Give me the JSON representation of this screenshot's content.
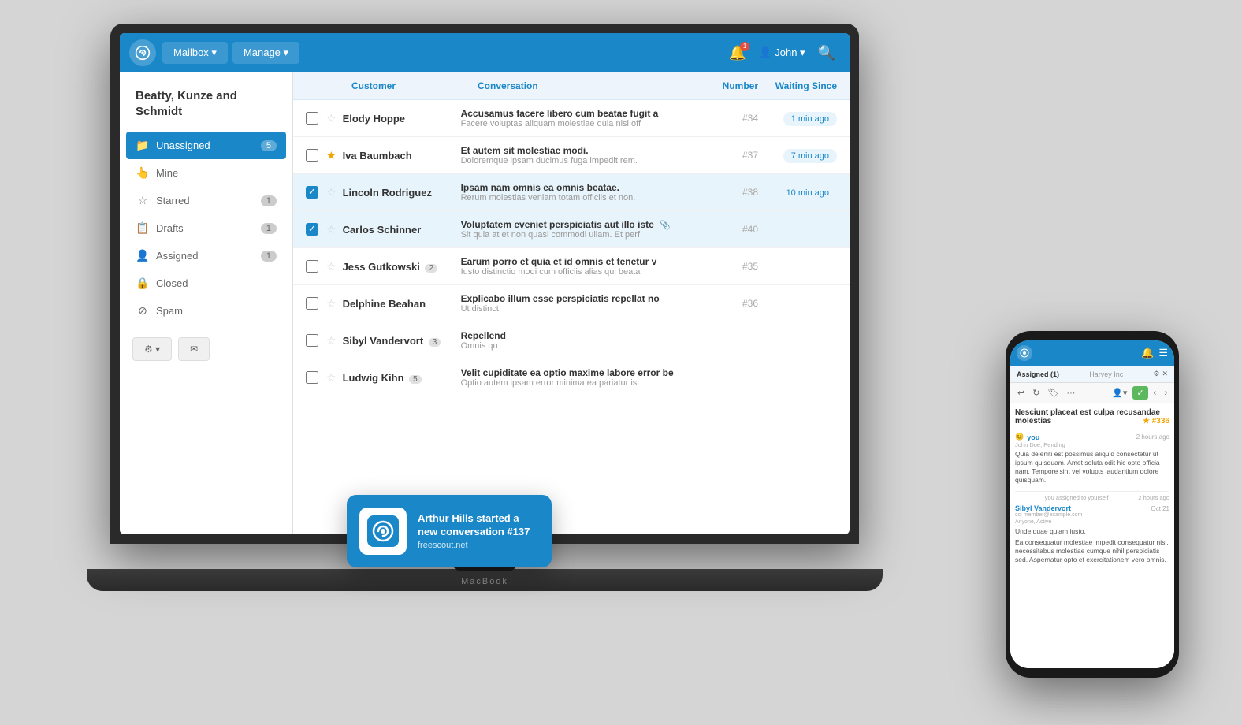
{
  "nav": {
    "logo_alt": "FreeScout",
    "mailbox_label": "Mailbox ▾",
    "manage_label": "Manage ▾",
    "user_label": "John ▾",
    "notification_count": "1"
  },
  "sidebar": {
    "company": "Beatty, Kunze and Schmidt",
    "items": [
      {
        "id": "unassigned",
        "label": "Unassigned",
        "icon": "📁",
        "badge": "5",
        "active": true
      },
      {
        "id": "mine",
        "label": "Mine",
        "icon": "👆",
        "badge": ""
      },
      {
        "id": "starred",
        "label": "Starred",
        "icon": "☆",
        "badge": "1"
      },
      {
        "id": "drafts",
        "label": "Drafts",
        "icon": "📋",
        "badge": "1"
      },
      {
        "id": "assigned",
        "label": "Assigned",
        "icon": "👤",
        "badge": "1"
      },
      {
        "id": "closed",
        "label": "Closed",
        "icon": "🔒",
        "badge": ""
      },
      {
        "id": "spam",
        "label": "Spam",
        "icon": "⊘",
        "badge": ""
      }
    ],
    "settings_label": "⚙ ▾",
    "compose_label": "✉"
  },
  "conversation_list": {
    "headers": {
      "customer": "Customer",
      "conversation": "Conversation",
      "number": "Number",
      "waiting_since": "Waiting Since"
    },
    "rows": [
      {
        "id": 1,
        "customer": "Elody Hoppe",
        "customer_badge": "",
        "starred": false,
        "subject": "Accusamus facere libero cum beatae fugit a",
        "preview": "Facere voluptas aliquam molestiae quia nisi off",
        "number": "#34",
        "waiting": "1 min ago",
        "checked": false,
        "has_attach": false
      },
      {
        "id": 2,
        "customer": "Iva Baumbach",
        "customer_badge": "",
        "starred": true,
        "subject": "Et autem sit molestiae modi.",
        "preview": "Doloremque ipsam ducimus fuga impedit rem.",
        "number": "#37",
        "waiting": "7 min ago",
        "checked": false,
        "has_attach": false
      },
      {
        "id": 3,
        "customer": "Lincoln Rodriguez",
        "customer_badge": "",
        "starred": false,
        "subject": "Ipsam nam omnis ea omnis beatae.",
        "preview": "Rerum molestias veniam totam officiis et non.",
        "number": "#38",
        "waiting": "10 min ago",
        "checked": true,
        "has_attach": false
      },
      {
        "id": 4,
        "customer": "Carlos Schinner",
        "customer_badge": "",
        "starred": false,
        "subject": "Voluptatem eveniet perspiciatis aut illo iste",
        "preview": "Sit quia at et non quasi commodi ullam. Et perf",
        "number": "#40",
        "waiting": "",
        "checked": true,
        "has_attach": true
      },
      {
        "id": 5,
        "customer": "Jess Gutkowski",
        "customer_badge": "2",
        "starred": false,
        "subject": "Earum porro et quia et id omnis et tenetur v",
        "preview": "Iusto distinctio modi cum officiis alias qui beata",
        "number": "#35",
        "waiting": "",
        "checked": false,
        "has_attach": false
      },
      {
        "id": 6,
        "customer": "Delphine Beahan",
        "customer_badge": "",
        "starred": false,
        "subject": "Explicabo illum esse perspiciatis repellat no",
        "preview": "Ut distinct",
        "number": "#36",
        "waiting": "",
        "checked": false,
        "has_attach": false
      },
      {
        "id": 7,
        "customer": "Sibyl Vandervort",
        "customer_badge": "3",
        "starred": false,
        "subject": "Repellend",
        "preview": "Omnis qu",
        "number": "",
        "waiting": "",
        "checked": false,
        "has_attach": false
      },
      {
        "id": 8,
        "customer": "Ludwig Kihn",
        "customer_badge": "5",
        "starred": false,
        "subject": "Velit cupiditate ea optio maxime labore error be",
        "preview": "Optio autem ipsam error minima ea pariatur ist",
        "number": "",
        "waiting": "",
        "checked": false,
        "has_attach": false
      }
    ]
  },
  "notification": {
    "title": "Arthur Hills started a new conversation #137",
    "url": "freescout.net"
  },
  "phone": {
    "assigned_label": "Assigned (1)",
    "company": "Harvey Inc",
    "msg_header": "Nesciunt placeat est culpa recusandae molestias",
    "msg_number": "#336",
    "sender_you": "you",
    "sender_time1": "2 hours ago",
    "sender_sub1": "John Doe, Pending",
    "chat_text1": "Quia deleniti est possimus aliquid consectetur ut ipsum quisquam. Amet soluta odit hic opto officia nam. Tempore sint vel volupts laudantium dolore quisquam.",
    "assigned_self": "you assigned to yourself",
    "assigned_time": "2 hours ago",
    "sender2": "Sibyl Vandervort",
    "sender2_email": "cc: member@example.com",
    "sender2_date": "Oct 21",
    "sender2_sub": "Anyone, Active",
    "chat_text2": "Unde quae quiam iusto.",
    "chat_text3": "Ea consequatur molestiae impedit consequatur nisi. necessitabus molestiae cumque nihil perspiciatis sed. Aspernatur opto et exercitationem vero omnis."
  },
  "laptop_label": "MacBook"
}
